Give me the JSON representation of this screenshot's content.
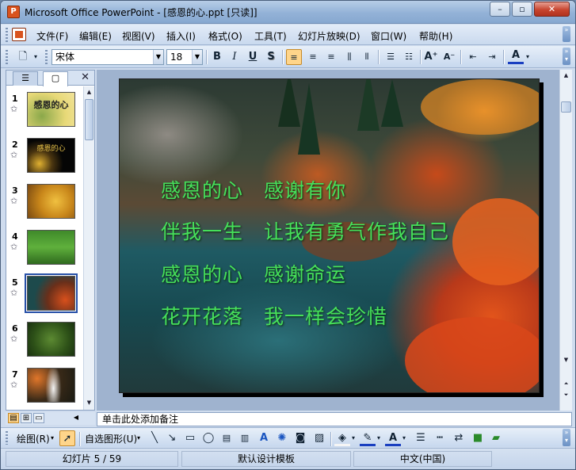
{
  "window": {
    "title": "Microsoft Office PowerPoint - [感恩的心.ppt [只读]]",
    "minimize": "–",
    "restore": "▫",
    "close": "✕"
  },
  "menubar": {
    "items": [
      "文件(F)",
      "编辑(E)",
      "视图(V)",
      "插入(I)",
      "格式(O)",
      "工具(T)",
      "幻灯片放映(D)",
      "窗口(W)",
      "帮助(H)"
    ]
  },
  "toolbar": {
    "font_name": "宋体",
    "font_size": "18",
    "bold": "B",
    "italic": "I",
    "underline": "U",
    "shadow": "S",
    "increase_font": "A⁺",
    "decrease_font": "A⁻",
    "font_color": "A"
  },
  "pane": {
    "close": "✕",
    "slides": [
      {
        "number": "1",
        "title": "感恩的心"
      },
      {
        "number": "2",
        "title": "感恩的心"
      },
      {
        "number": "3",
        "title": ""
      },
      {
        "number": "4",
        "title": ""
      },
      {
        "number": "5",
        "title": "",
        "selected": true
      },
      {
        "number": "6",
        "title": ""
      },
      {
        "number": "7",
        "title": ""
      }
    ],
    "star": "✩"
  },
  "slide": {
    "lines": [
      "感恩的心　感谢有你",
      "伴我一生　让我有勇气作我自己",
      "感恩的心　感谢命运",
      "花开花落　我一样会珍惜"
    ]
  },
  "notes": {
    "placeholder": "单击此处添加备注"
  },
  "drawing": {
    "draw_label": "绘图(R)",
    "autoshapes_label": "自选图形(U)"
  },
  "status": {
    "slide_position": "幻灯片 5 / 59",
    "design": "默认设计模板",
    "language": "中文(中国)"
  },
  "colors": {
    "poem_text": "#46e05a",
    "selection": "#2750a8"
  }
}
